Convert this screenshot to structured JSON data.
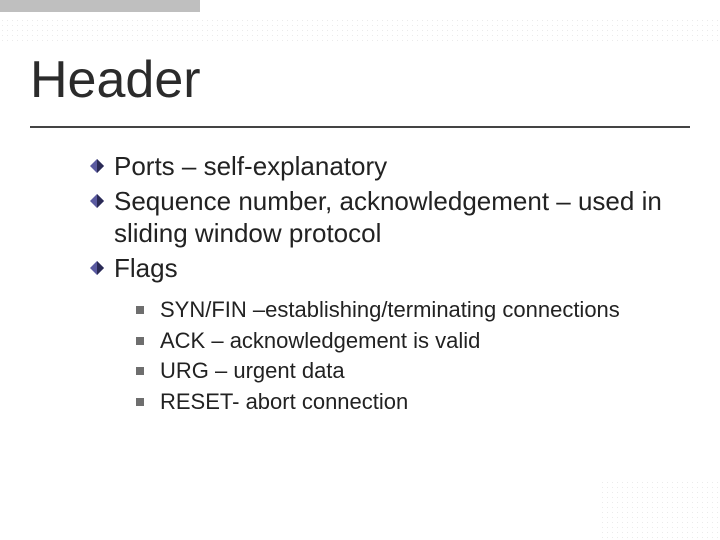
{
  "header": {
    "title": "Header"
  },
  "bullets": [
    {
      "text": "Ports – self-explanatory"
    },
    {
      "text": "Sequence number, acknowledgement – used in sliding window protocol"
    },
    {
      "text": "Flags"
    }
  ],
  "sub_bullets": [
    {
      "text": "SYN/FIN –establishing/terminating connections"
    },
    {
      "text": "ACK – acknowledgement is valid"
    },
    {
      "text": "URG – urgent data"
    },
    {
      "text": "RESET- abort connection"
    }
  ]
}
